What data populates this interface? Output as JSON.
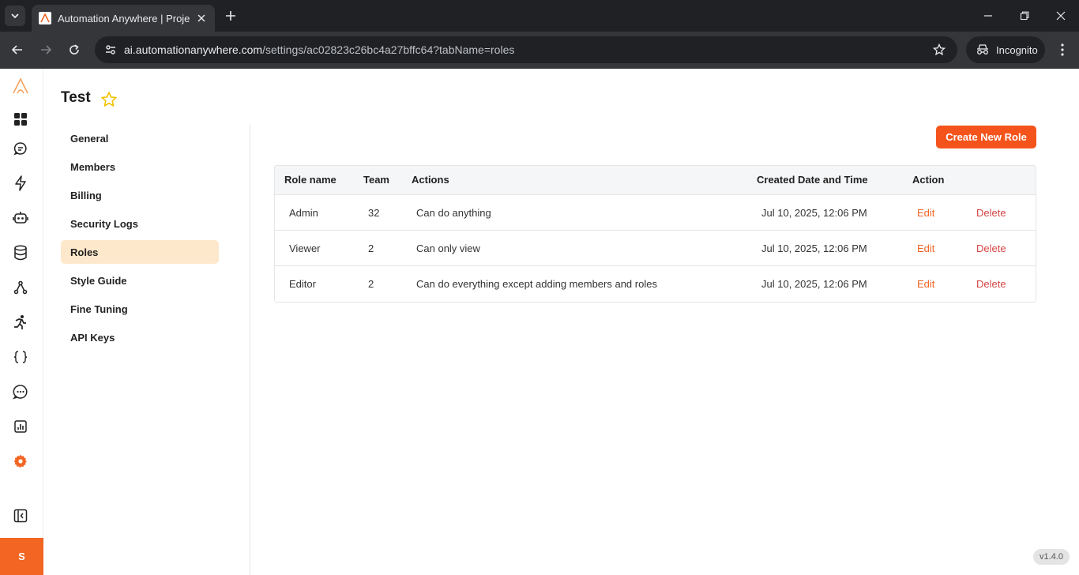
{
  "browser": {
    "tab_title": "Automation Anywhere | Project",
    "url_host": "ai.automationanywhere.com",
    "url_path": "/settings/ac02823c26bc4a27bffc64?tabName=roles",
    "incognito_label": "Incognito"
  },
  "app": {
    "avatar_initial": "S",
    "version": "v1.4.0"
  },
  "page": {
    "title": "Test",
    "create_button": "Create New Role"
  },
  "settings_nav": [
    {
      "label": "General",
      "active": false
    },
    {
      "label": "Members",
      "active": false
    },
    {
      "label": "Billing",
      "active": false
    },
    {
      "label": "Security Logs",
      "active": false
    },
    {
      "label": "Roles",
      "active": true
    },
    {
      "label": "Style Guide",
      "active": false
    },
    {
      "label": "Fine Tuning",
      "active": false
    },
    {
      "label": "API Keys",
      "active": false
    }
  ],
  "table": {
    "headers": {
      "role_name": "Role name",
      "team": "Team",
      "actions": "Actions",
      "created": "Created Date and Time",
      "action": "Action"
    },
    "rows": [
      {
        "role": "Admin",
        "team": "32",
        "actions": "Can do anything",
        "created": "Jul 10, 2025, 12:06 PM",
        "edit": "Edit",
        "delete": "Delete"
      },
      {
        "role": "Viewer",
        "team": "2",
        "actions": "Can only view",
        "created": "Jul 10, 2025, 12:06 PM",
        "edit": "Edit",
        "delete": "Delete"
      },
      {
        "role": "Editor",
        "team": "2",
        "actions": "Can do everything except adding members and roles",
        "created": "Jul 10, 2025, 12:06 PM",
        "edit": "Edit",
        "delete": "Delete"
      }
    ]
  },
  "colors": {
    "accent": "#f26522",
    "active_nav_bg": "#fde8cb",
    "delete": "#d64545"
  }
}
